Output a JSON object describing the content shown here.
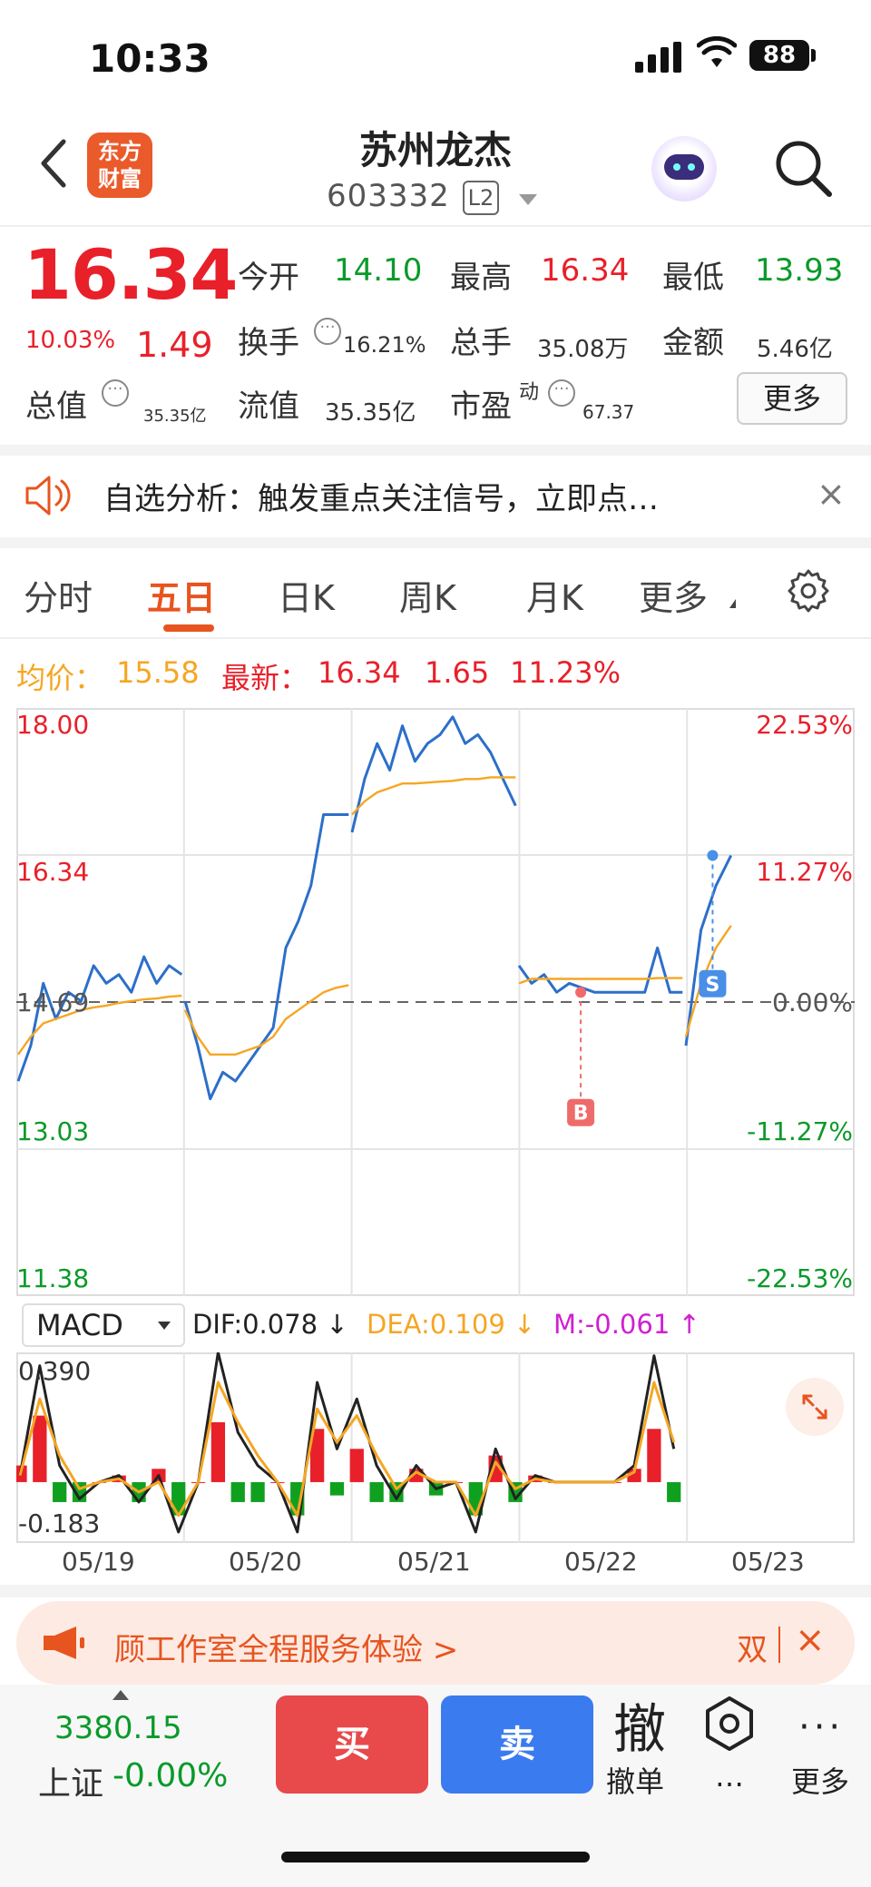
{
  "status_bar": {
    "time": "10:33",
    "battery": "88"
  },
  "nav": {
    "logo_line1": "东方",
    "logo_line2": "财富",
    "title": "苏州龙杰",
    "code": "603332",
    "level": "L2"
  },
  "quote": {
    "price": "16.34",
    "change_pct": "10.03%",
    "change": "1.49",
    "open_label": "今开",
    "open": "14.10",
    "high_label": "最高",
    "high": "16.34",
    "low_label": "最低",
    "low": "13.93",
    "turnover_label": "换手",
    "turnover": "16.21%",
    "volume_label": "总手",
    "volume": "35.08万",
    "amount_label": "金额",
    "amount": "5.46亿",
    "mcap_label": "总值",
    "mcap": "35.35亿",
    "float_label": "流值",
    "float": "35.35亿",
    "pe_label": "市盈",
    "pe_sup": "动",
    "pe": "67.37",
    "more": "更多"
  },
  "notice": {
    "text": "自选分析：触发重点关注信号，立即点…",
    "close": "×"
  },
  "tabs": [
    {
      "label": "分时"
    },
    {
      "label": "五日"
    },
    {
      "label": "日K"
    },
    {
      "label": "周K"
    },
    {
      "label": "月K"
    },
    {
      "label": "更多"
    }
  ],
  "avg_row": {
    "avg_label": "均价：",
    "avg": "15.58",
    "latest_label": "最新：",
    "latest": "16.34",
    "chg": "1.65",
    "pct": "11.23%"
  },
  "chart_data": {
    "type": "line",
    "title": "",
    "y_left_labels": [
      "18.00",
      "16.34",
      "14.69",
      "13.03",
      "11.38"
    ],
    "y_right_labels": [
      "22.53%",
      "11.27%",
      "0.00%",
      "-11.27%",
      "-22.53%"
    ],
    "ylim": [
      11.38,
      18.0
    ],
    "prev_close": 14.69,
    "x_labels": [
      "05/19",
      "05/20",
      "05/21",
      "05/22",
      "05/23"
    ],
    "series": [
      {
        "color": "#2c6fc9",
        "days": [
          [
            13.8,
            14.2,
            14.9,
            14.5,
            14.8,
            14.7,
            15.1,
            14.9,
            15.0,
            14.8,
            15.2,
            14.9,
            15.1,
            15.0
          ],
          [
            14.7,
            14.2,
            13.6,
            13.9,
            13.8,
            14.0,
            14.2,
            14.4,
            15.3,
            15.6,
            16.0,
            16.8,
            16.8,
            16.8
          ],
          [
            16.6,
            17.2,
            17.6,
            17.3,
            17.8,
            17.4,
            17.6,
            17.7,
            17.9,
            17.6,
            17.7,
            17.5,
            17.2,
            16.9
          ],
          [
            15.1,
            14.9,
            15.0,
            14.8,
            14.9,
            14.85,
            14.8,
            14.8,
            14.8,
            14.8,
            14.8,
            15.3,
            14.8,
            14.8
          ],
          [
            14.2,
            15.5,
            16.0,
            16.34
          ]
        ]
      },
      {
        "color": "#f5a623",
        "days": [
          [
            14.1,
            14.3,
            14.45,
            14.5,
            14.55,
            14.6,
            14.63,
            14.65,
            14.68,
            14.7,
            14.72,
            14.73,
            14.75,
            14.76
          ],
          [
            14.6,
            14.3,
            14.1,
            14.1,
            14.1,
            14.15,
            14.2,
            14.3,
            14.5,
            14.6,
            14.7,
            14.8,
            14.85,
            14.88
          ],
          [
            16.8,
            16.95,
            17.05,
            17.1,
            17.15,
            17.15,
            17.16,
            17.17,
            17.18,
            17.2,
            17.2,
            17.22,
            17.22,
            17.22
          ],
          [
            14.9,
            14.95,
            14.95,
            14.95,
            14.95,
            14.95,
            14.95,
            14.95,
            14.95,
            14.95,
            14.95,
            14.96,
            14.96,
            14.96
          ],
          [
            14.3,
            14.9,
            15.3,
            15.55
          ]
        ]
      }
    ],
    "markers": [
      {
        "label": "B",
        "color": "#ef6b6b"
      },
      {
        "label": "S",
        "color": "#4a8fe7"
      }
    ]
  },
  "macd": {
    "selector": "MACD",
    "dif": "DIF:0.078 ↓",
    "dea": "DEA:0.109 ↓",
    "m": "M:-0.061 ↑",
    "max_label": "0.390",
    "min_label": "-0.183",
    "dif_line": [
      0.02,
      0.35,
      0.05,
      -0.05,
      0.0,
      0.02,
      -0.06,
      0.02,
      -0.15,
      0.0,
      0.39,
      0.15,
      0.05,
      0.0,
      -0.15,
      0.3,
      0.1,
      0.25,
      0.05,
      -0.05,
      0.05,
      -0.02,
      0.0,
      -0.15,
      0.1,
      -0.05,
      0.02,
      0.0,
      0.0,
      0.0,
      0.0,
      0.05,
      0.38,
      0.1
    ],
    "dea_line": [
      0.02,
      0.25,
      0.08,
      -0.02,
      0.0,
      0.01,
      -0.03,
      0.0,
      -0.1,
      0.0,
      0.3,
      0.18,
      0.08,
      0.0,
      -0.1,
      0.22,
      0.12,
      0.2,
      0.08,
      -0.02,
      0.03,
      0.0,
      0.0,
      -0.1,
      0.06,
      -0.02,
      0.01,
      0.0,
      0.0,
      0.0,
      0.0,
      0.03,
      0.3,
      0.12
    ],
    "bars": [
      0.05,
      0.2,
      -0.06,
      -0.06,
      0.0,
      0.02,
      -0.06,
      0.04,
      -0.1,
      0.0,
      0.18,
      -0.06,
      -0.06,
      0.0,
      -0.1,
      0.16,
      -0.04,
      0.1,
      -0.06,
      -0.06,
      0.04,
      -0.04,
      0.0,
      -0.1,
      0.08,
      -0.06,
      0.02,
      0.0,
      0.0,
      0.0,
      0.0,
      0.04,
      0.16,
      -0.06
    ]
  },
  "banner": {
    "text": "顾工作室全程服务体验 >",
    "dbl": "双",
    "close": "×"
  },
  "bottom": {
    "index_value": "3380.15",
    "index_name": "上证",
    "index_pct": "-0.00%",
    "buy": "买",
    "sell": "卖",
    "cancel_big": "撤",
    "cancel": "撤单",
    "dots": "…",
    "more_dots": "···",
    "more": "更多"
  },
  "colors": {
    "red": "#e8202a",
    "green": "#0a9a2a",
    "orange": "#e8541f",
    "blue": "#2c6fc9",
    "avg": "#f5a623"
  }
}
